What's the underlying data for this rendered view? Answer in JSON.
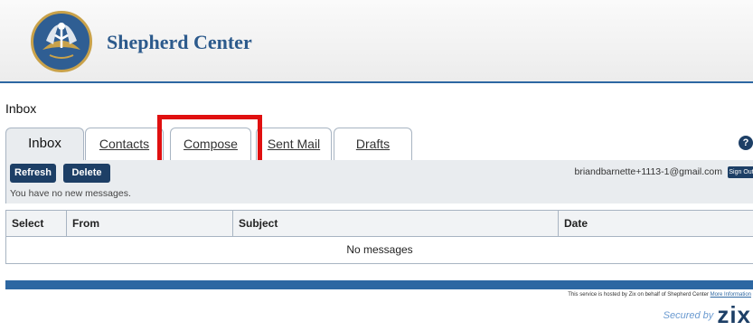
{
  "header": {
    "brand": "Shepherd Center"
  },
  "page": {
    "title": "Inbox"
  },
  "tabs": [
    {
      "label": "Inbox"
    },
    {
      "label": "Contacts"
    },
    {
      "label": "Compose"
    },
    {
      "label": "Sent Mail"
    },
    {
      "label": "Drafts"
    }
  ],
  "help_label": "?",
  "toolbar": {
    "refresh_label": "Refresh",
    "delete_label": "Delete",
    "user_email": "briandbarnette+1113-1@gmail.com",
    "signout_label": "Sign Out",
    "status": "You have no new messages."
  },
  "table": {
    "headers": [
      "Select",
      "From",
      "Subject",
      "Date"
    ],
    "empty_text": "No messages"
  },
  "footer": {
    "note": "This service is hosted by Zix on behalf of Shepherd Center",
    "more_info": "More Information",
    "secured_by": "Secured by",
    "zix": "zix"
  },
  "colors": {
    "accent": "#2d67a2",
    "button": "#1d3f66",
    "highlight": "#e01010"
  }
}
